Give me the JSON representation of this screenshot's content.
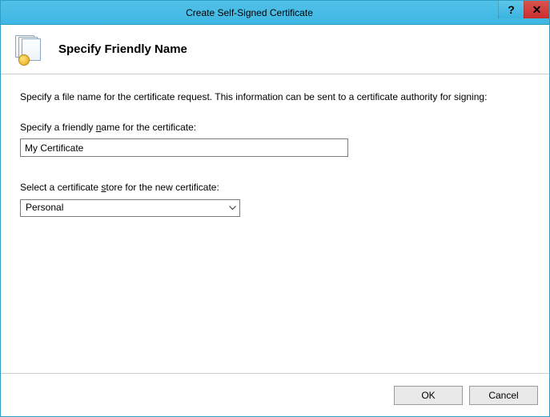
{
  "window": {
    "title": "Create Self-Signed Certificate"
  },
  "header": {
    "title": "Specify Friendly Name"
  },
  "content": {
    "description": "Specify a file name for the certificate request.  This information can be sent to a certificate authority for signing:",
    "friendly_label_pre": "Specify a friendly ",
    "friendly_label_u": "n",
    "friendly_label_post": "ame for the certificate:",
    "friendly_value": "My Certificate",
    "store_label_pre": "Select a certificate ",
    "store_label_u": "s",
    "store_label_post": "tore for the new certificate:",
    "store_value": "Personal"
  },
  "footer": {
    "ok": "OK",
    "cancel": "Cancel"
  }
}
